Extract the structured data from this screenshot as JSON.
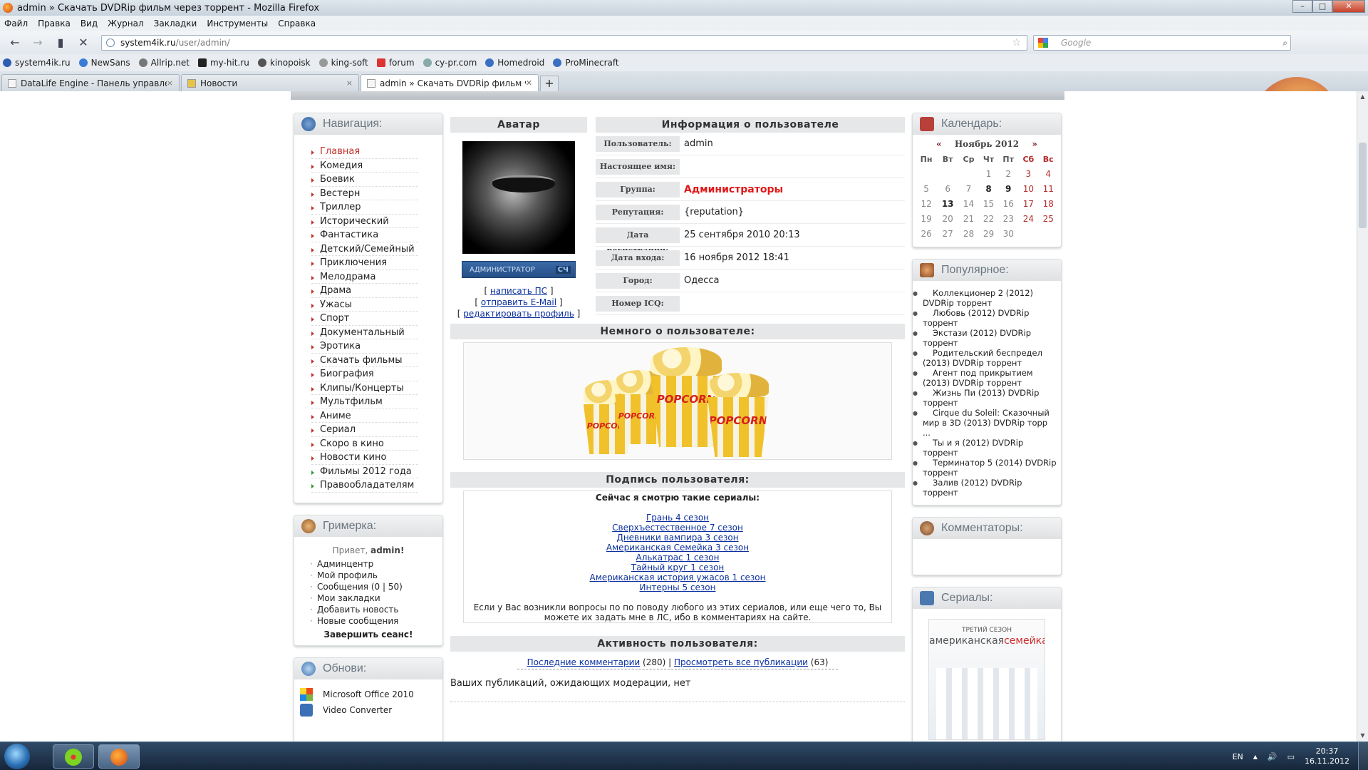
{
  "window": {
    "title": "admin » Скачать DVDRip фильм через торрент - Mozilla Firefox",
    "controls": {
      "minimize": "–",
      "maximize": "□",
      "close": "✕"
    }
  },
  "menu": [
    "Файл",
    "Правка",
    "Вид",
    "Журнал",
    "Закладки",
    "Инструменты",
    "Справка"
  ],
  "navbar": {
    "back": "←",
    "forward": "→",
    "stop": "✕",
    "url_domain": "system4ik.ru",
    "url_path": "/user/admin/",
    "star": "☆",
    "search_placeholder": "Google",
    "search_icon": "⌕"
  },
  "bookmarks": [
    "system4ik.ru",
    "NewSans",
    "Allrip.net",
    "my-hit.ru",
    "kinopoisk",
    "king-soft",
    "forum",
    "cy-pr.com",
    "Homedroid",
    "ProMinecraft"
  ],
  "tabs": [
    {
      "label": "DataLife Engine - Панель управления",
      "close": "×"
    },
    {
      "label": "Новости",
      "close": "×"
    },
    {
      "label": "admin » Скачать DVDRip фильм чер...",
      "close": "✕"
    }
  ],
  "new_tab": "+",
  "left": {
    "nav_title": "Навигация:",
    "nav_items": [
      "Главная",
      "Комедия",
      "Боевик",
      "Вестерн",
      "Триллер",
      "Исторический",
      "Фантастика",
      "Детский/Семейный",
      "Приключения",
      "Мелодрама",
      "Драма",
      "Ужасы",
      "Спорт",
      "Документальный",
      "Эротика",
      "Скачать фильмы",
      "Биография",
      "Клипы/Концерты",
      "Мультфильм",
      "Аниме",
      "Сериал",
      "Скоро в кино",
      "Новости кино",
      "Фильмы 2012 года",
      "Правообладателям"
    ],
    "grim_title": "Гримерка:",
    "greeting_prefix": "Привет, ",
    "greeting_user": "admin!",
    "user_menu": [
      "Админцентр",
      "Мой профиль",
      "Сообщения (0 | 50)",
      "Мои закладки",
      "Добавить новость",
      "Новые сообщения"
    ],
    "logout": "Завершить сеанс!",
    "upd_title": "Обнови:",
    "updates": [
      "Microsoft Office 2010",
      "Video Converter"
    ]
  },
  "profile": {
    "avatar_title": "Аватар",
    "info_title": "Информация о пользователе",
    "role_badge": "АДМИНИСТРАТОР",
    "role_tag": "СЧ",
    "link_pm": "написать ПС",
    "link_email": "отправить E-Mail",
    "link_edit": "редактировать профиль",
    "fields": [
      {
        "label": "Пользователь:",
        "value": "admin"
      },
      {
        "label": "Настоящее имя:",
        "value": ""
      },
      {
        "label": "Группа:",
        "value": "Администраторы"
      },
      {
        "label": "Репутация:",
        "value": "{reputation}"
      },
      {
        "label": "Дата регистрации:",
        "value": "25 сентября 2010 20:13"
      },
      {
        "label": "Дата входа:",
        "value": "16 ноября 2012 18:41"
      },
      {
        "label": "Город:",
        "value": "Одесса"
      },
      {
        "label": "Номер ICQ:",
        "value": ""
      }
    ],
    "about_title": "Немного о пользователе:",
    "popcorn_text": "POPCORN",
    "sig_title": "Подпись пользователя:",
    "sig_heading": "Сейчас я смотрю такие сериалы:",
    "series": [
      "Грань 4 сезон",
      "Сверхъестественное 7 сезон",
      "Дневники вампира 3 сезон",
      "Американская Семейка 3 сезон",
      "Алькатрас 1 сезон",
      "Тайный круг 1 сезон",
      "Американская история ужасов 1 сезон",
      "Интерны 5 сезон"
    ],
    "sig_note": "Если у Вас возникли вопросы по по поводу любого из этих сериалов, или еще чего то, Вы можете их задать мне в ЛС, ибо в комментариях на сайте.",
    "act_title": "Активность пользователя:",
    "act_comments": "Последние комментарии",
    "act_comments_count": "(280)",
    "act_sep": "|",
    "act_pubs": "Просмотреть все публикации",
    "act_pubs_count": "(63)",
    "pending": "Ваших публикаций, ожидающих модерации, нет"
  },
  "right": {
    "cal_title": "Календарь:",
    "cal_prev": "«",
    "cal_month": "Ноябрь 2012",
    "cal_next": "»",
    "weekdays": [
      "Пн",
      "Вт",
      "Ср",
      "Чт",
      "Пт",
      "Сб",
      "Вс"
    ],
    "weeks": [
      [
        "",
        "",
        "",
        "1",
        "2",
        "3",
        "4"
      ],
      [
        "5",
        "6",
        "7",
        "8",
        "9",
        "10",
        "11"
      ],
      [
        "12",
        "13",
        "14",
        "15",
        "16",
        "17",
        "18"
      ],
      [
        "19",
        "20",
        "21",
        "22",
        "23",
        "24",
        "25"
      ],
      [
        "26",
        "27",
        "28",
        "29",
        "30",
        "",
        ""
      ]
    ],
    "pop_title": "Популярное:",
    "popular": [
      "Коллекционер 2 (2012) DVDRip торрент",
      "Любовь (2012) DVDRip торрент",
      "Экстази (2012) DVDRip торрент",
      "Родительский беспредел (2013) DVDRip торрент",
      "Агент под прикрытием (2013) DVDRip торрент",
      "Жизнь Пи (2013) DVDRip торрент",
      "Cirque du Soleil: Сказочный мир в 3D (2013) DVDRip торр ...",
      "Ты и я (2012) DVDRip торрент",
      "Терминатор 5 (2014) DVDRip торрент",
      "Залив (2012) DVDRip торрент"
    ],
    "comm_title": "Комментаторы:",
    "ser_title": "Сериалы:",
    "poster_top": "ТРЕТИЙ СЕЗОН",
    "poster_a": "американская",
    "poster_b": "семейка"
  },
  "taskbar": {
    "lang": "EN",
    "tray_up": "▲",
    "time": "20:37",
    "date": "16.11.2012"
  },
  "colors": {
    "accent_red": "#e01818",
    "link": "#0a2f9e",
    "nav_arrow": "#c0342b"
  }
}
